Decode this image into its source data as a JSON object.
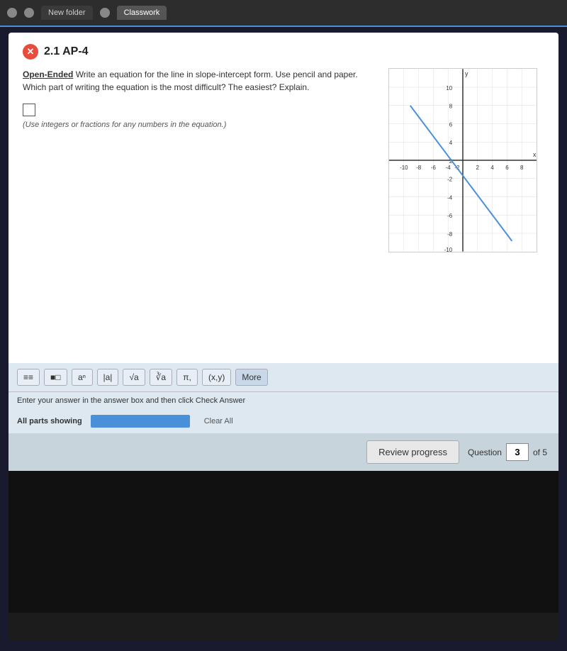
{
  "browser": {
    "tabs": [
      {
        "label": "New folder",
        "active": false
      },
      {
        "label": "Classwork",
        "active": true
      }
    ]
  },
  "question": {
    "id": "2.1 AP-4",
    "type_label": "Open-Ended",
    "prompt": "Write an equation for the line in slope-intercept form. Use pencil and paper. Which part of writing the equation is the most difficult? The easiest? Explain.",
    "hint": "(Use integers or fractions for any numbers in the equation.)",
    "close_icon": "✕"
  },
  "toolbar": {
    "buttons": [
      {
        "label": "≡≡",
        "name": "fraction-btn"
      },
      {
        "label": "■□",
        "name": "mixed-num-btn"
      },
      {
        "label": "aⁿ",
        "name": "exponent-btn"
      },
      {
        "label": "|a|",
        "name": "abs-btn"
      },
      {
        "label": "√a",
        "name": "sqrt-btn"
      },
      {
        "label": "∛a",
        "name": "cbrt-btn"
      },
      {
        "label": "π,",
        "name": "pi-btn"
      },
      {
        "label": "(x,y)",
        "name": "coord-btn"
      },
      {
        "label": "More",
        "name": "more-btn"
      }
    ]
  },
  "instruction": "Enter your answer in the answer box and then click Check Answer",
  "all_parts": {
    "label": "All parts showing",
    "clear_label": "Clear All"
  },
  "bottom_nav": {
    "review_label": "Review progress",
    "question_label": "Question",
    "question_number": "3",
    "of_label": "of 5"
  },
  "graph": {
    "x_axis_label": "x",
    "y_axis_label": "y",
    "x_ticks": [
      "-10",
      "-8",
      "-6",
      "-4",
      "-2",
      "2",
      "4",
      "6",
      "8"
    ],
    "y_ticks": [
      "10",
      "8",
      "6",
      "4",
      "2",
      "-2",
      "-4",
      "-6",
      "-8",
      "-10"
    ]
  }
}
